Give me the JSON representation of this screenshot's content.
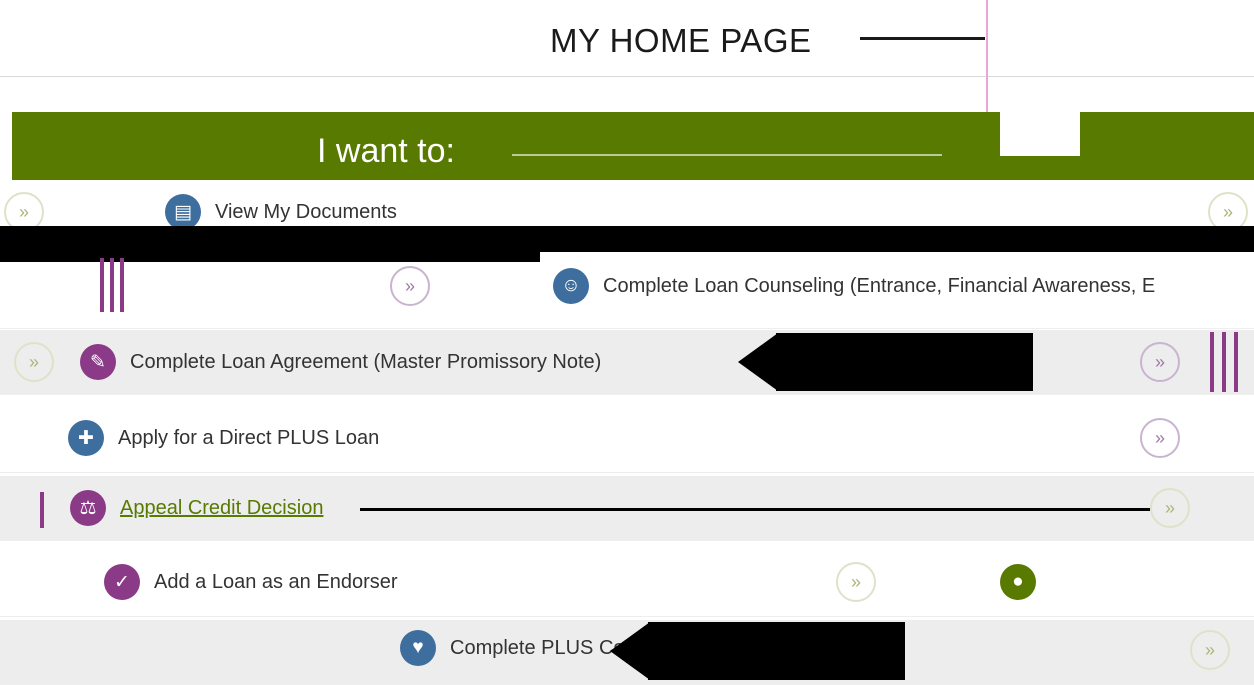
{
  "header": {
    "title": "MY HOME PAGE"
  },
  "banner": {
    "label": "I want to:"
  },
  "actions": [
    {
      "label": "View My Documents",
      "icon": "document-icon"
    },
    {
      "label": "Complete Loan Counseling (Entrance, Financial Awareness, E",
      "icon": "counseling-icon"
    },
    {
      "label": "Complete Loan Agreement (Master Promissory Note)",
      "icon": "signature-icon"
    },
    {
      "label": "Apply for a Direct PLUS Loan",
      "icon": "apply-icon"
    },
    {
      "label": "Appeal Credit Decision",
      "icon": "appeal-icon"
    },
    {
      "label": "Add a Loan as an Endorser",
      "icon": "endorser-icon"
    },
    {
      "label": "Complete PLUS Counseling",
      "icon": "plus-counseling-icon"
    }
  ],
  "colors": {
    "brand_green": "#587a00",
    "icon_blue": "#3d6e9e",
    "icon_purple": "#8a3a86",
    "row_shade": "#ededed"
  }
}
